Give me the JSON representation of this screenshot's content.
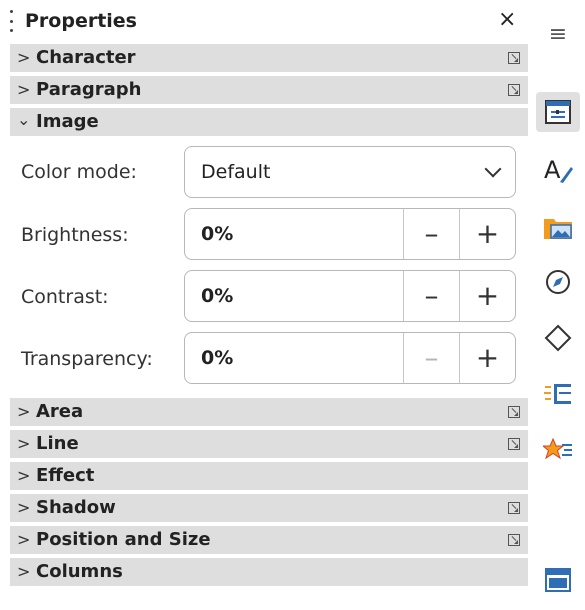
{
  "panel": {
    "title": "Properties",
    "close": "×"
  },
  "sections_top": [
    {
      "label": "Character",
      "expanded": false,
      "has_more": true
    },
    {
      "label": "Paragraph",
      "expanded": false,
      "has_more": true
    },
    {
      "label": "Image",
      "expanded": true,
      "has_more": false
    }
  ],
  "image": {
    "color_mode_label": "Color mode:",
    "color_mode_value": "Default",
    "brightness_label": "Brightness:",
    "brightness_value": "0%",
    "contrast_label": "Contrast:",
    "contrast_value": "0%",
    "transparency_label": "Transparency:",
    "transparency_value": "0%",
    "minus": "–",
    "plus": "+"
  },
  "sections_bottom": [
    {
      "label": "Area",
      "has_more": true
    },
    {
      "label": "Line",
      "has_more": true
    },
    {
      "label": "Effect",
      "has_more": false
    },
    {
      "label": "Shadow",
      "has_more": true
    },
    {
      "label": "Position and Size",
      "has_more": true
    },
    {
      "label": "Columns",
      "has_more": false
    }
  ],
  "sidebar": {
    "menu": "≡",
    "items": [
      "properties-icon",
      "styles-icon",
      "gallery-icon",
      "navigator-icon",
      "shapes-icon",
      "animation-icon",
      "slide-transition-icon",
      "master-slides-icon"
    ]
  },
  "colors": {
    "section_bg": "#dedede",
    "accent_blue": "#2f6db5",
    "accent_orange": "#f29b1d"
  }
}
